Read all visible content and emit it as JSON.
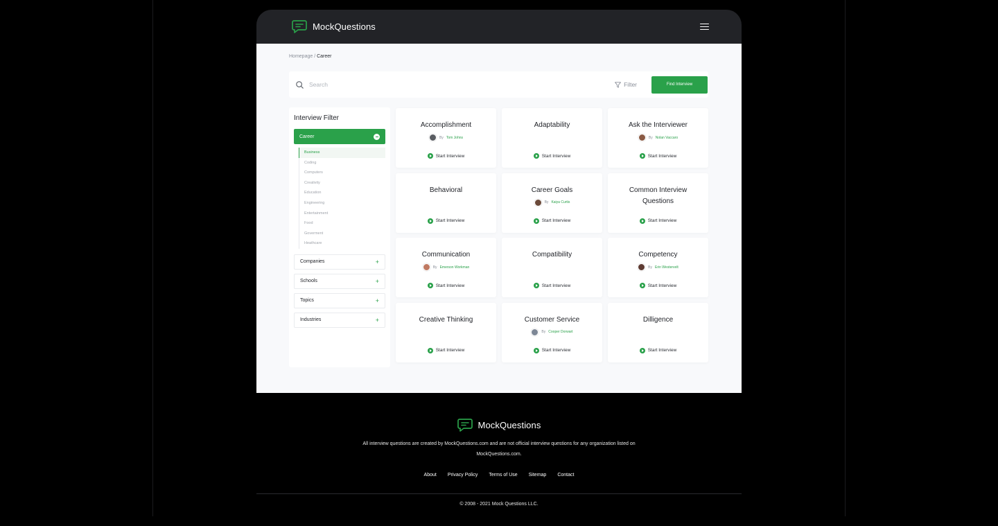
{
  "brand": {
    "name": "MockQuestions",
    "accent": "#2aa14a"
  },
  "breadcrumb": {
    "home": "Homepage",
    "separator": " / ",
    "current": "Career"
  },
  "search": {
    "placeholder": "Search",
    "filter_label": "Filter",
    "button_label": "Find Interview"
  },
  "sidebar": {
    "title": "Interview Filter",
    "active_category": "Career",
    "subcategories": [
      "Business",
      "Coding",
      "Computers",
      "Creativity",
      "Education",
      "Engineering",
      "Entertainment",
      "Food",
      "Goverment",
      "Heathcare"
    ],
    "categories": [
      "Companies",
      "Schools",
      "Topics",
      "Industries"
    ]
  },
  "cards": [
    {
      "title": "Accomplishment",
      "by": "By",
      "author": "Tom Johns",
      "action": "Start Interview"
    },
    {
      "title": "Adaptability",
      "by": "",
      "author": "",
      "action": "Start Interview"
    },
    {
      "title": "Ask the Interviewer",
      "by": "By",
      "author": "Nolan Vaccaro",
      "action": "Start Interview"
    },
    {
      "title": "Behavioral",
      "by": "",
      "author": "",
      "action": "Start Interview"
    },
    {
      "title": "Career Goals",
      "by": "By",
      "author": "Kaiya Curtis",
      "action": "Start Interview"
    },
    {
      "title": "Common Interview Questions",
      "by": "",
      "author": "",
      "action": "Start Interview"
    },
    {
      "title": "Communication",
      "by": "By",
      "author": "Emerson Workman",
      "action": "Start Interview"
    },
    {
      "title": "Compatibility",
      "by": "",
      "author": "",
      "action": "Start Interview"
    },
    {
      "title": "Competency",
      "by": "By",
      "author": "Erin Westervelt",
      "action": "Start Interview"
    },
    {
      "title": "Creative Thinking",
      "by": "",
      "author": "",
      "action": "Start Interview"
    },
    {
      "title": "Customer Service",
      "by": "By",
      "author": "Cooper Dorwart",
      "action": "Start Interview"
    },
    {
      "title": "Dilligence",
      "by": "",
      "author": "",
      "action": "Start Interview"
    }
  ],
  "footer": {
    "disclaimer": "All interview questions are created by MockQuestions.com and are not official interview questions for any organization listed on MockQuestions.com.",
    "links": [
      "About",
      "Privacy Policy",
      "Terms of Use",
      "Sitemap",
      "Contact"
    ],
    "copyright": "© 2008 - 2021 Mock Questions LLC."
  }
}
